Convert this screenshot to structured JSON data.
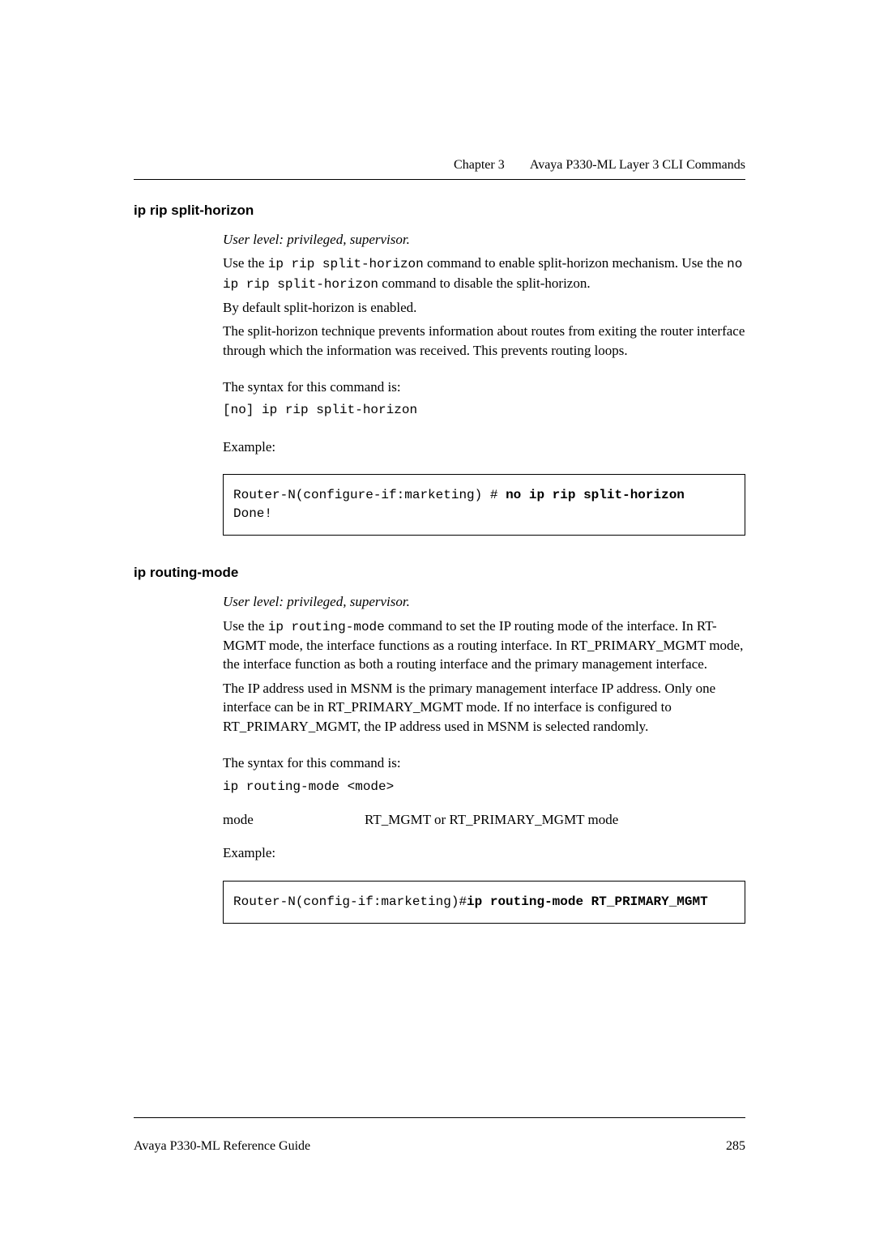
{
  "header": {
    "chapter": "Chapter 3",
    "title": "Avaya P330-ML Layer 3 CLI Commands"
  },
  "sections": [
    {
      "heading": "ip rip split-horizon",
      "userLevel": "User level: privileged, supervisor.",
      "intro1_pre": "Use the ",
      "intro1_code": "ip rip split-horizon",
      "intro1_post": " command to enable split-horizon mechanism. Use the ",
      "intro1_code2": "no ip rip split-horizon",
      "intro1_post2": " command to  disable the split-horizon.",
      "intro2": "By default split-horizon is enabled.",
      "intro3": "The split-horizon technique prevents information about routes from exiting the router interface through which the information was received. This prevents routing loops.",
      "syntaxLabel": "The syntax for this command is:",
      "syntax": "[no] ip rip split-horizon",
      "exampleLabel": "Example:",
      "codeLines": {
        "prompt": "Router-N(configure-if:marketing) # ",
        "cmd": "no ip rip split-horizon",
        "out": "Done!"
      }
    },
    {
      "heading": "ip routing-mode",
      "userLevel": "User level: privileged, supervisor.",
      "intro1_pre": "Use the ",
      "intro1_code": "ip routing-mode",
      "intro1_post": " command to set the IP routing mode of the interface. In RT-MGMT mode, the interface functions as a routing interface. In RT_PRIMARY_MGMT mode, the interface function as both a routing interface and the primary management interface.",
      "intro2": "The IP address used in MSNM is the primary management interface IP address. Only one interface can be in RT_PRIMARY_MGMT mode. If no interface is configured to RT_PRIMARY_MGMT, the IP address used in MSNM is selected randomly.",
      "syntaxLabel": "The syntax for this command is:",
      "syntax": "ip routing-mode <mode>",
      "param": {
        "name": "mode",
        "desc": "RT_MGMT or RT_PRIMARY_MGMT mode"
      },
      "exampleLabel": "Example:",
      "codeLines": {
        "prompt": "Router-N(config-if:marketing)#",
        "cmd": "ip routing-mode RT_PRIMARY_MGMT"
      }
    }
  ],
  "footer": {
    "docTitle": "Avaya P330-ML Reference Guide",
    "pageNum": "285"
  }
}
